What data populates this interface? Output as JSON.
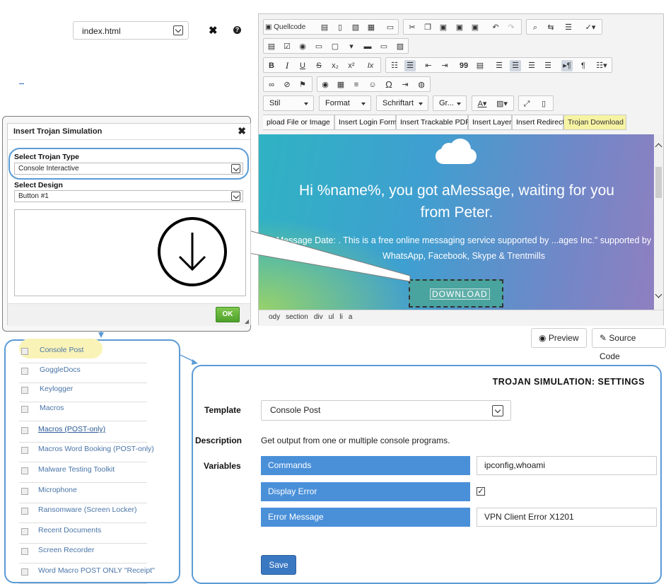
{
  "file_select": {
    "value": "index.html"
  },
  "editor": {
    "toolbar_rows": [
      [
        [
          "Quellcode",
          "save-icon",
          "new-page-icon",
          "preview-icon",
          "print-icon",
          "templates-icon"
        ],
        [
          "cut-icon",
          "copy-icon",
          "paste-icon",
          "paste-text-icon",
          "paste-word-icon",
          "undo-icon",
          "redo-icon"
        ],
        [
          "find-icon",
          "replace-icon",
          "select-all-icon",
          "spellcheck-icon"
        ]
      ],
      [
        [
          "form-icon",
          "checkbox-icon",
          "radio-icon",
          "textfield-icon",
          "textarea-icon",
          "select-icon",
          "button-icon",
          "image-button-icon",
          "hidden-field-icon"
        ]
      ],
      [
        [
          "bold-icon",
          "italic-icon",
          "underline-icon",
          "strike-icon",
          "subscript-icon",
          "superscript-icon",
          "remove-format-icon"
        ],
        [
          "numbered-list-icon",
          "bulleted-list-icon",
          "outdent-icon",
          "indent-icon",
          "blockquote-icon",
          "div-icon",
          "align-left-icon",
          "align-center-icon",
          "align-right-icon",
          "justify-icon",
          "ltr-icon",
          "rtl-icon",
          "language-icon"
        ]
      ],
      [
        [
          "link-icon",
          "unlink-icon",
          "anchor-icon"
        ],
        [
          "flash-icon",
          "table-icon",
          "horizontal-rule-icon",
          "smiley-icon",
          "special-char-icon",
          "page-break-icon",
          "iframe-icon"
        ]
      ]
    ],
    "toolbar_glyphs": {
      "quellcode": "Quellcode",
      "bold": "B",
      "italic": "I",
      "underline": "U",
      "strike": "S",
      "subscript": "x₂",
      "superscript": "x²",
      "remove_format": "Ix",
      "blockquote": "99",
      "special_char": "Ω",
      "rtl": "¶"
    },
    "combos": {
      "stil": "Stil",
      "format": "Format",
      "schriftart": "Schriftart",
      "groesse": "Gr..."
    },
    "custom_buttons": [
      "pload File or Image",
      "Insert Login Form",
      "Insert Trackable PDF",
      "Insert Layer",
      "Insert Redirect",
      "Trojan Download"
    ],
    "preview": {
      "title": "Hi %name%, you got aMessage, waiting for you from Peter.",
      "subtitle": "Message Date: . This is a free online messaging service supported by ...ages Inc.\" supported by WhatsApp, Facebook, Skype & Trentmills",
      "download_label": "DOWNLOAD"
    },
    "path": [
      "ody",
      "section",
      "div",
      "ul",
      "li",
      "a"
    ]
  },
  "actions": {
    "preview": "Preview",
    "source_code": "Source Code"
  },
  "modal": {
    "title": "Insert Trojan Simulation",
    "close": "✖",
    "trojan_type_label": "Select Trojan Type",
    "trojan_type_value": "Console Interactive",
    "design_label": "Select Design",
    "design_value": "Button #1",
    "ok": "OK"
  },
  "templates": [
    "Console Post",
    "GoggleDocs",
    "Keylogger",
    "Macros",
    "Macros (POST-only)",
    "Macros Word Booking (POST-only)",
    "Malware Testing Toolkit",
    "Microphone",
    "Ransomware (Screen Locker)",
    "Recent Documents",
    "Screen Recorder",
    "Word Macro POST ONLY \"Receipt\""
  ],
  "settings": {
    "title": "TROJAN SIMULATION: SETTINGS",
    "template_label": "Template",
    "template_value": "Console Post",
    "description_label": "Description",
    "description": "Get output from one or multiple console programs.",
    "variables_label": "Variables",
    "variables": [
      {
        "key": "Commands",
        "value": "ipconfig,whoami"
      },
      {
        "key": "Display Error",
        "checked": true,
        "check_glyph": "✓"
      },
      {
        "key": "Error Message",
        "value": "VPN Client Error X1201"
      }
    ],
    "save": "Save"
  },
  "colors": {
    "accent": "#4a90d9",
    "panel_border": "#5b9bd5",
    "highlight": "#faf3b8",
    "ok_green": "#4ea02a"
  }
}
